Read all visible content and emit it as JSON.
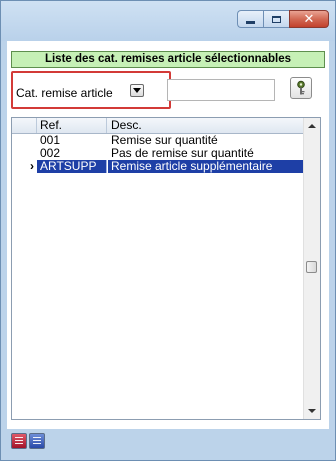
{
  "window": {
    "minimize_icon": "minimize-icon",
    "maximize_icon": "maximize-icon",
    "close_glyph": "✕"
  },
  "panel": {
    "title": "Liste des cat. remises article sélectionnables"
  },
  "filter": {
    "selected_option": "Cat. remise article",
    "search_value": "",
    "search_icon": "key-search-icon"
  },
  "table": {
    "columns": [
      "Ref.",
      "Desc."
    ],
    "rows": [
      {
        "ref": "001",
        "desc": "Remise sur quantité",
        "pointer": ""
      },
      {
        "ref": "002",
        "desc": "Pas de remise sur quantité",
        "pointer": ""
      },
      {
        "ref": "ARTSUPP",
        "desc": "Remise article supplémentaire",
        "pointer": "›"
      }
    ],
    "selected_row": 2
  },
  "colors": {
    "header_bg": "#c6f0b6",
    "selection_bg": "#1e3fa6",
    "highlight_border": "#d33a37",
    "frame_bg": "#bcd3ea"
  },
  "footer": {
    "buttons": [
      "red-book-icon",
      "blue-book-icon"
    ]
  }
}
